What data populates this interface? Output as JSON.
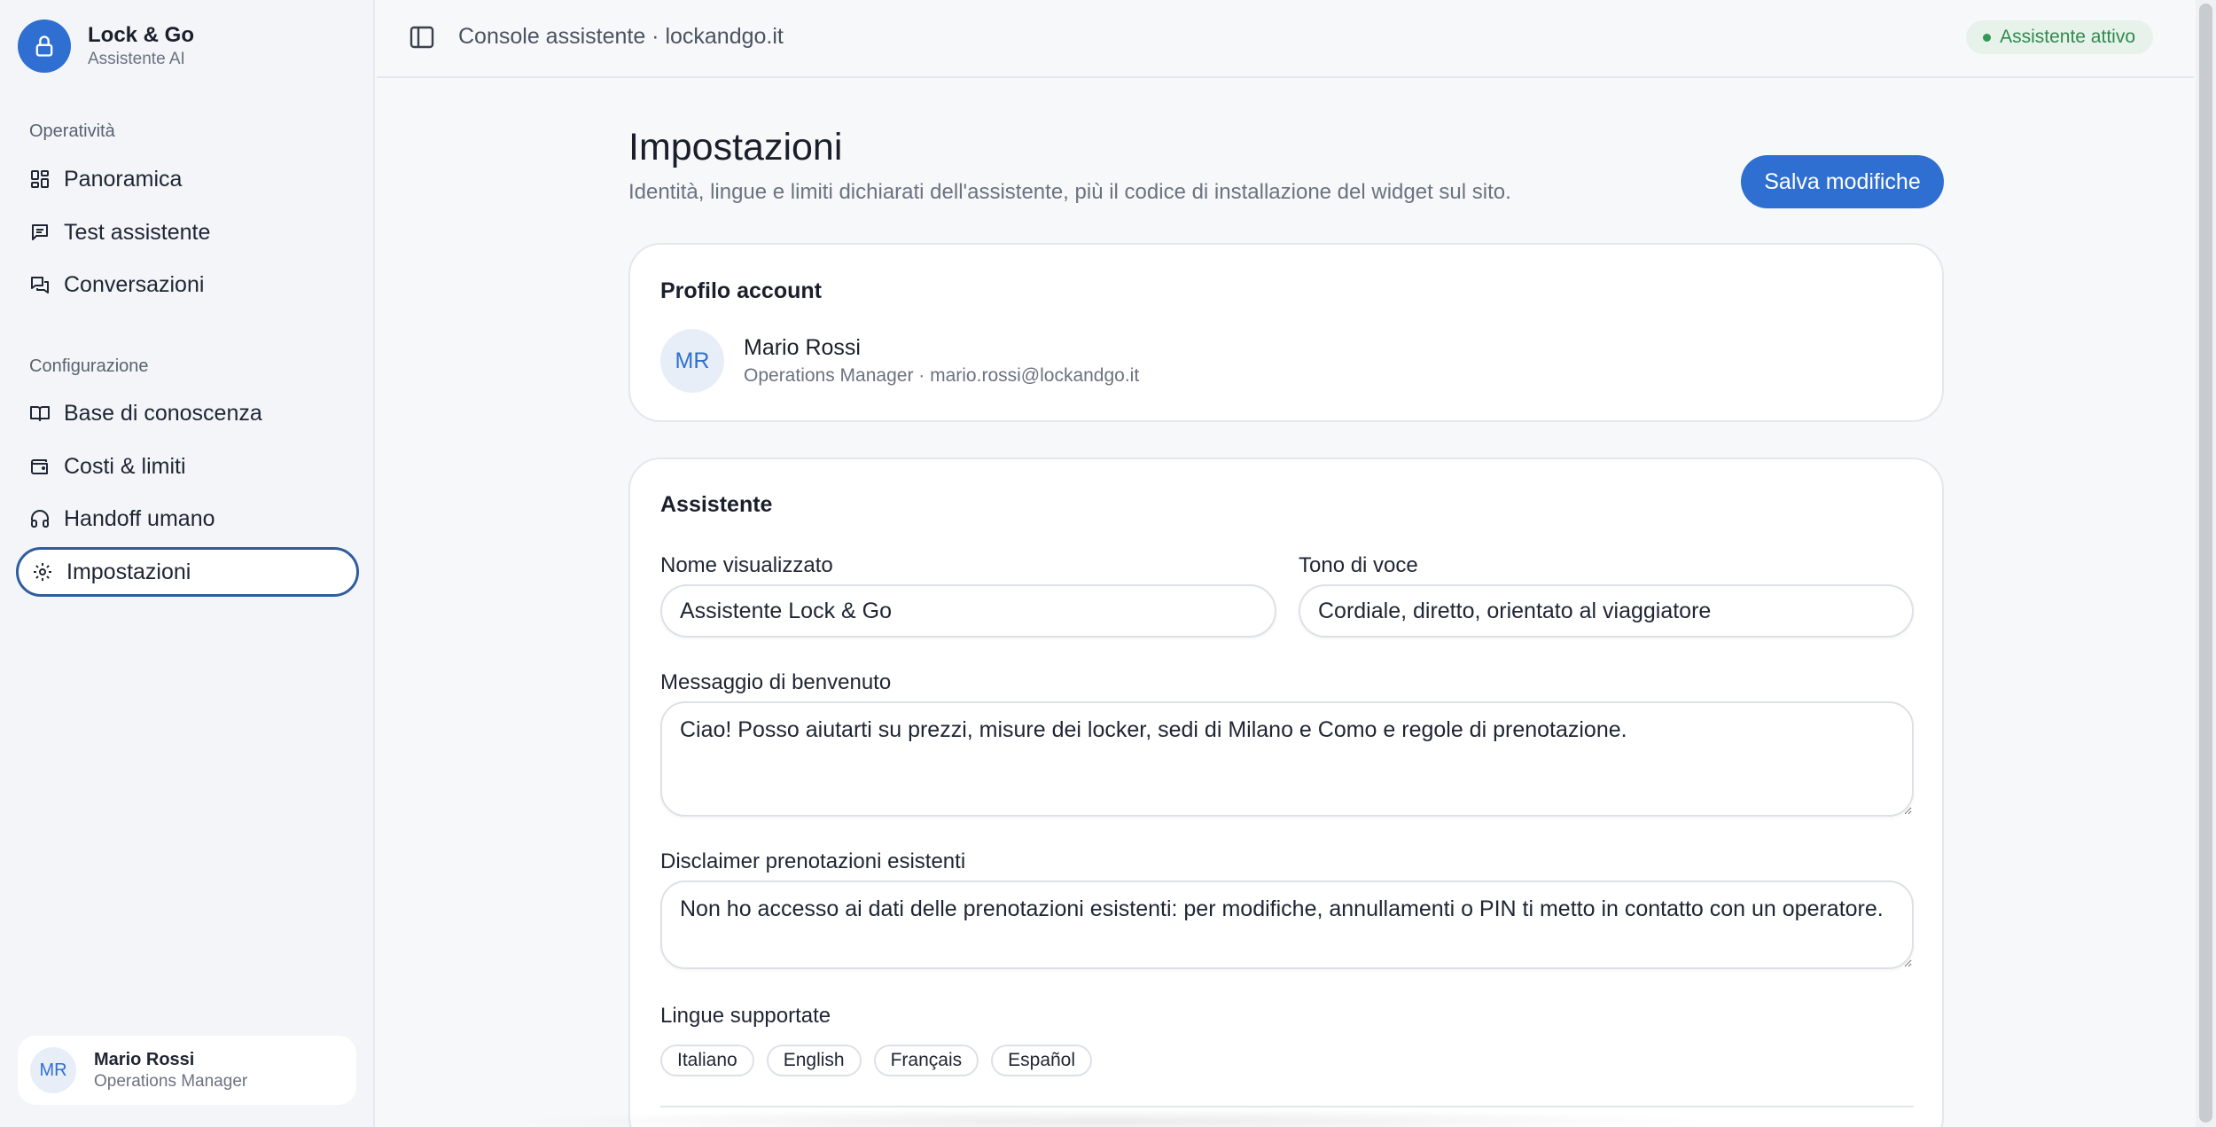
{
  "brand": {
    "title": "Lock & Go",
    "subtitle": "Assistente AI"
  },
  "sidebar": {
    "sections": [
      {
        "label": "Operatività"
      },
      {
        "label": "Configurazione"
      }
    ],
    "items": [
      {
        "label": "Panoramica",
        "icon": "grid-icon"
      },
      {
        "label": "Test assistente",
        "icon": "message-icon"
      },
      {
        "label": "Conversazioni",
        "icon": "chat-bubbles-icon"
      },
      {
        "label": "Base di conoscenza",
        "icon": "book-icon"
      },
      {
        "label": "Costi & limiti",
        "icon": "wallet-icon"
      },
      {
        "label": "Handoff umano",
        "icon": "headset-icon"
      },
      {
        "label": "Impostazioni",
        "icon": "gear-icon",
        "active": true
      }
    ],
    "user": {
      "initials": "MR",
      "name": "Mario Rossi",
      "role": "Operations Manager"
    }
  },
  "topbar": {
    "title": "Console assistente · lockandgo.it",
    "status": "Assistente attivo"
  },
  "page": {
    "title": "Impostazioni",
    "subtitle": "Identità, lingue e limiti dichiarati dell'assistente, più il codice di installazione del widget sul sito.",
    "save_label": "Salva modifiche"
  },
  "profile": {
    "title": "Profilo account",
    "initials": "MR",
    "name": "Mario Rossi",
    "meta": "Operations Manager · mario.rossi@lockandgo.it"
  },
  "assistant": {
    "title": "Assistente",
    "display_name_label": "Nome visualizzato",
    "display_name_value": "Assistente Lock & Go",
    "tone_label": "Tono di voce",
    "tone_value": "Cordiale, diretto, orientato al viaggiatore",
    "welcome_label": "Messaggio di benvenuto",
    "welcome_value": "Ciao! Posso aiutarti su prezzi, misure dei locker, sedi di Milano e Como e regole di prenotazione.",
    "disclaimer_label": "Disclaimer prenotazioni esistenti",
    "disclaimer_value": "Non ho accesso ai dati delle prenotazioni esistenti: per modifiche, annullamenti o PIN ti metto in contatto con un operatore.",
    "languages_label": "Lingue supportate",
    "languages": [
      "Italiano",
      "English",
      "Français",
      "Español"
    ]
  },
  "colors": {
    "accent": "#2f6fd1",
    "active_border": "#2f5c9e",
    "status_bg": "#e7f2ea",
    "status_text": "#2f8a4e"
  }
}
